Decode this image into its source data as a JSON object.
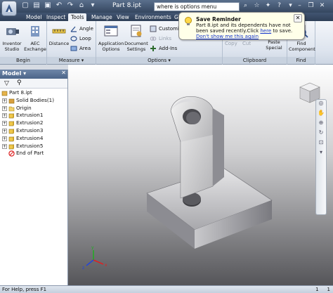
{
  "window": {
    "doc_title": "Part 8.ipt",
    "search_value": "where is options menu"
  },
  "tabs": [
    "Model",
    "Inspect",
    "Tools",
    "Manage",
    "View",
    "Environments",
    "Ge"
  ],
  "active_tab": "Tools",
  "ribbon": {
    "begin": {
      "label": "Begin",
      "inventor_studio": "Inventor Studio",
      "aec_exchange": "AEC Exchange"
    },
    "measure": {
      "label": "Measure",
      "distance": "Distance",
      "angle": "Angle",
      "loop": "Loop",
      "area": "Area"
    },
    "options": {
      "label": "Options",
      "application_options": "Application Options",
      "document_settings": "Document Settings",
      "customize": "Customi",
      "links": "Links",
      "addins": "Add-Ins"
    },
    "clipboard": {
      "label": "Clipboard",
      "copy": "Copy",
      "cut": "Cut",
      "paste_special": "Paste Special"
    },
    "find": {
      "label": "Find",
      "find_component": "Find Component"
    }
  },
  "balloon": {
    "title": "Save Reminder",
    "body": "Part 8.ipt and its dependents have not been saved recently.Click",
    "link_here": "here",
    "body_end": "to save.",
    "dont_show": "Don't show me this again"
  },
  "browser": {
    "title": "Model",
    "items": [
      {
        "label": "Part 8.ipt",
        "level": 0,
        "icon": "part-icon"
      },
      {
        "label": "Solid Bodies(1)",
        "level": 1,
        "icon": "solid-bodies-icon",
        "expandable": true
      },
      {
        "label": "Origin",
        "level": 1,
        "icon": "folder-icon",
        "expandable": true
      },
      {
        "label": "Extrusion1",
        "level": 1,
        "icon": "extrusion-icon",
        "expandable": true
      },
      {
        "label": "Extrusion2",
        "level": 1,
        "icon": "extrusion-icon",
        "expandable": true
      },
      {
        "label": "Extrusion3",
        "level": 1,
        "icon": "extrusion-icon",
        "expandable": true
      },
      {
        "label": "Extrusion4",
        "level": 1,
        "icon": "extrusion-icon",
        "expandable": true
      },
      {
        "label": "Extrusion5",
        "level": 1,
        "icon": "extrusion-icon",
        "expandable": true
      },
      {
        "label": "End of Part",
        "level": 1,
        "icon": "end-of-part-icon"
      }
    ]
  },
  "status": {
    "help": "For Help, press F1",
    "num1": "1",
    "num2": "1"
  },
  "colors": {
    "accent": "#3f5677",
    "tab_active": "#eef2f7",
    "balloon": "#ffffe9"
  }
}
